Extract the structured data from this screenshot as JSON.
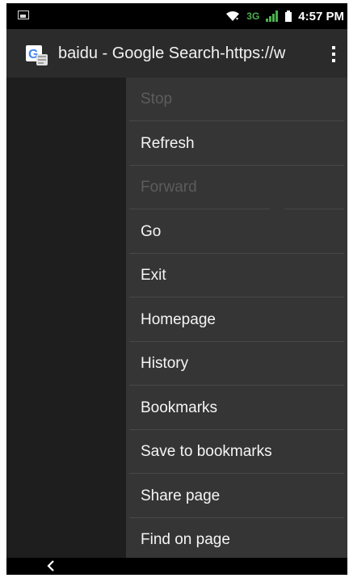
{
  "status_bar": {
    "network": "3G",
    "time": "4:57 PM",
    "icons": [
      "image-notification-icon",
      "wifi-icon",
      "signal-icon",
      "battery-icon"
    ]
  },
  "app_bar": {
    "site_icon": "google-search-icon",
    "title": "baidu - Google Search-https://w",
    "overflow_icon": "overflow-menu-icon"
  },
  "menu": {
    "items": [
      {
        "label": "Stop",
        "enabled": false
      },
      {
        "label": "Refresh",
        "enabled": true
      },
      {
        "label": "Forward",
        "enabled": false
      },
      {
        "label": "Go",
        "enabled": true
      },
      {
        "label": "Exit",
        "enabled": true
      },
      {
        "label": "Homepage",
        "enabled": true
      },
      {
        "label": "History",
        "enabled": true
      },
      {
        "label": "Bookmarks",
        "enabled": true
      },
      {
        "label": "Save to bookmarks",
        "enabled": true
      },
      {
        "label": "Share page",
        "enabled": true
      },
      {
        "label": "Find on page",
        "enabled": true
      }
    ]
  },
  "nav_bar": {
    "back_icon": "back-icon"
  },
  "colors": {
    "menu_background": "#353535",
    "disabled_text": "#5c5c5c",
    "network_indicator": "#4caf50",
    "app_bar": "#2b2b2b"
  }
}
